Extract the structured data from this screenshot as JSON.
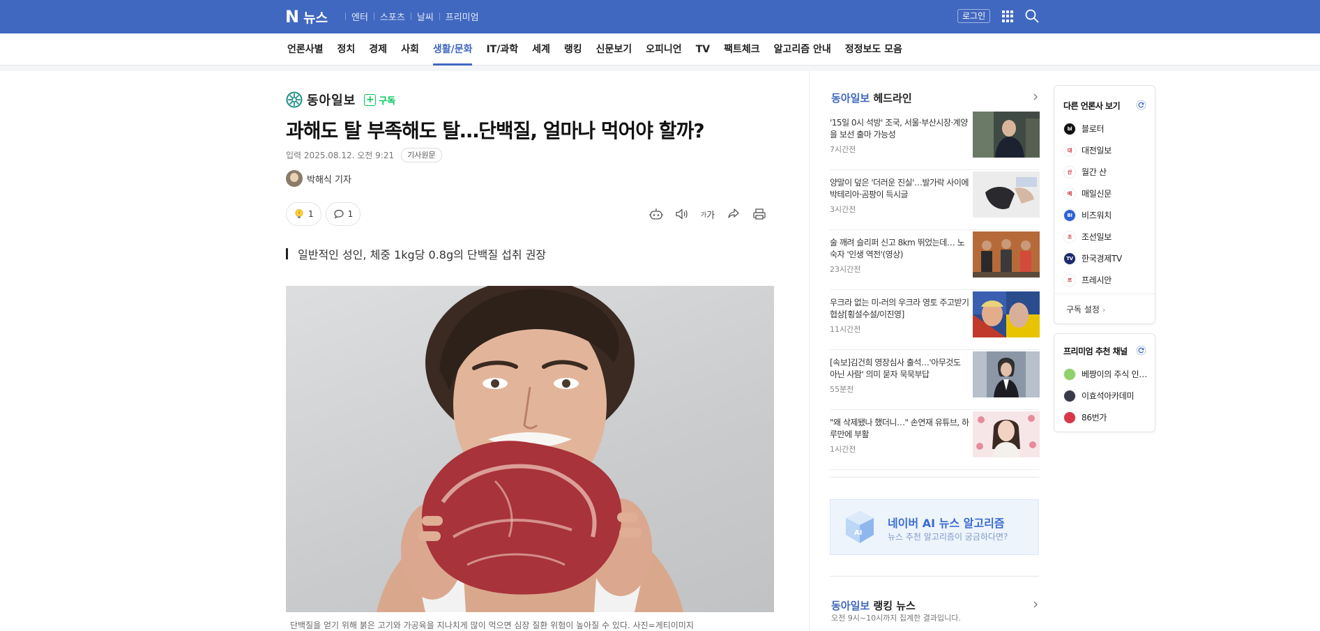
{
  "topbar": {
    "logo_letter": "N",
    "logo_title": "뉴스",
    "service_links": [
      "엔터",
      "스포츠",
      "날씨",
      "프리미엄"
    ],
    "login_label": "로그인"
  },
  "categories": {
    "items": [
      "언론사별",
      "정치",
      "경제",
      "사회",
      "생활/문화",
      "IT/과학",
      "세계",
      "랭킹",
      "신문보기",
      "오피니언",
      "TV",
      "팩트체크",
      "알고리즘 안내",
      "정정보도 모음"
    ],
    "active": "생활/문화"
  },
  "article": {
    "press_name": "동아일보",
    "subscribe_label": "구독",
    "headline": "과해도 탈 부족해도 탈…단백질, 얼마나 먹어야 할까?",
    "date_label": "입력",
    "date_value": "2025.08.12. 오전 9:21",
    "original_button": "기사원문",
    "reporter": "박해식 기자",
    "reaction_count": "1",
    "comment_count": "1",
    "text_size_label": "가",
    "summary": "일반적인 성인, 체중 1kg당 0.8g의 단백질 섭취 권장",
    "caption": "단백질을 얻기 위해 붉은 고기와 가공육을 지나치게 많이 먹으면 심장 질환 위험이 높아질 수 있다. 사진=게티이미지"
  },
  "headlines": {
    "press": "동아일보",
    "title_suffix": " 헤드라인",
    "items": [
      {
        "text": "'15일 0시 석방' 조국, 서울·부산시장·계양을 보선 출마 가능성",
        "time": "7시간전"
      },
      {
        "text": "양말이 덮은 '더러운 진실'…발가락 사이에 박테리아·곰팡이 득시글",
        "time": "3시간전"
      },
      {
        "text": "술 깨려 슬리퍼 신고 8km 뛰었는데… 노숙자 '인생 역전'(영상)",
        "time": "23시간전"
      },
      {
        "text": "우크라 없는 미-러의 우크라 영토 주고받기 협상[횡설수설/이진영]",
        "time": "11시간전"
      },
      {
        "text": "[속보]김건희 영장심사 출석…'아무것도 아닌 사람' 의미 묻자 묵묵부답",
        "time": "55분전"
      },
      {
        "text": "\"왜 삭제됐나 했더니…\" 손연재 유튜브, 하루만에 부활",
        "time": "1시간전"
      }
    ]
  },
  "ai_banner": {
    "title": "네이버 AI 뉴스 알고리즘",
    "subtitle": "뉴스 추천 알고리즘이 궁금하다면?",
    "icon_text": "AI"
  },
  "ranking": {
    "press": "동아일보",
    "title_suffix": " 랭킹 뉴스",
    "subtitle": "오전 9시~10시까지 집계한 결과입니다."
  },
  "other_press": {
    "title": "다른 언론사 보기",
    "items": [
      {
        "name": "블로터",
        "color": "#111111",
        "mark": "bl"
      },
      {
        "name": "대전일보",
        "color": "#ffffff",
        "mark": "대"
      },
      {
        "name": "월간 산",
        "color": "#ffffff",
        "mark": "산"
      },
      {
        "name": "매일신문",
        "color": "#ffffff",
        "mark": "매"
      },
      {
        "name": "비즈워치",
        "color": "#2d62d6",
        "mark": "BI"
      },
      {
        "name": "조선일보",
        "color": "#ffffff",
        "mark": "조"
      },
      {
        "name": "한국경제TV",
        "color": "#1e2a6e",
        "mark": "TV"
      },
      {
        "name": "프레시안",
        "color": "#ffffff",
        "mark": "프"
      }
    ],
    "setting_label": "구독 설정"
  },
  "premium": {
    "title": "프리미엄 추천 채널",
    "items": [
      {
        "name": "베짱이의 주식 인사이트",
        "color": "#8fd16a"
      },
      {
        "name": "이효석아카데미",
        "color": "#3a3a4a"
      },
      {
        "name": "86번가",
        "color": "#d8384a"
      }
    ]
  },
  "colors": {
    "brand_blue": "#4168c0",
    "subscribe_green": "#03c75a"
  }
}
